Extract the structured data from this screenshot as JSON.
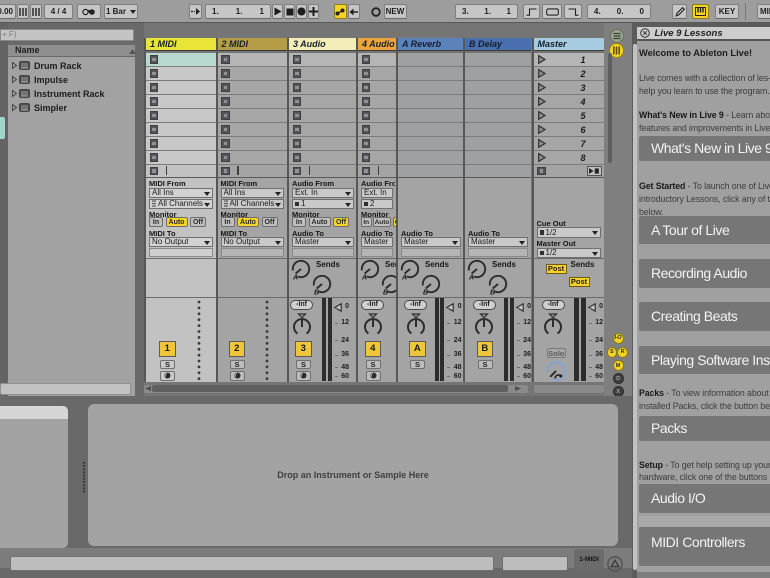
{
  "colors": {
    "accent_yellow": "#f5d329",
    "selected_slot_teal": "#b7d9cf",
    "track_colors": [
      "#e9e438",
      "#b59d48",
      "#f4edb8",
      "#eda438",
      "#5b82bb",
      "#4a6fae",
      "#a7cce2"
    ],
    "banner_grey": "#767676",
    "panel_grey": "#a0a0a0"
  },
  "control_bar": {
    "tempo_partial": "0.00",
    "time_signature": "4 / 4",
    "quantization": "1 Bar",
    "position": [
      "1",
      "1",
      "1"
    ],
    "session_record_new": "NEW",
    "loop_start": [
      "3",
      "1",
      "1"
    ],
    "loop_length": [
      "4",
      "0",
      "0"
    ],
    "key_map_label": "KEY",
    "midi_map_label_partial": "MID"
  },
  "browser": {
    "search_text_partial": "+ F)",
    "name_header": "Name",
    "items": [
      "Drum Rack",
      "Impulse",
      "Instrument Rack",
      "Simpler"
    ]
  },
  "session": {
    "tracks": [
      {
        "name": "1 MIDI",
        "color": "#e9e438",
        "kind": "midi",
        "selected": true,
        "io": {
          "from_label": "MIDI From",
          "from_value": "All Ins",
          "chan_value": "All Channels",
          "monitor_label": "Monitor",
          "monitor_active": "Auto",
          "to_label": "MIDI To",
          "to_value": "No Output"
        },
        "mixer": {
          "number": "1",
          "solo": "S",
          "arm": true,
          "meter": "dotted"
        }
      },
      {
        "name": "2 MIDI",
        "color": "#b59d48",
        "kind": "midi",
        "selected": false,
        "io": {
          "from_label": "MIDI From",
          "from_value": "All Ins",
          "chan_value": "All Channels",
          "monitor_label": "Monitor",
          "monitor_active": "Auto",
          "to_label": "MIDI To",
          "to_value": "No Output"
        },
        "mixer": {
          "number": "2",
          "solo": "S",
          "arm": true,
          "meter": "dotted"
        }
      },
      {
        "name": "3 Audio",
        "color": "#f4edb8",
        "kind": "audio",
        "selected": false,
        "io": {
          "from_label": "Audio From",
          "from_value": "Ext. In",
          "chan_value": "1",
          "monitor_label": "Monitor",
          "monitor_active": "Off",
          "to_label": "Audio To",
          "to_value": "Master"
        },
        "sends": [
          "A",
          "B"
        ],
        "mixer": {
          "number": "3",
          "solo": "S",
          "arm": true,
          "meter": "bars",
          "volume": "-Inf"
        }
      },
      {
        "name": "4 Audio",
        "color": "#eda438",
        "kind": "audio",
        "selected": false,
        "io": {
          "from_label": "Audio From",
          "from_value": "Ext. In",
          "chan_value": "2",
          "monitor_label": "Monitor",
          "monitor_active": "Off",
          "to_label": "Audio To",
          "to_value": "Master"
        },
        "sends": [
          "A",
          "B"
        ],
        "mixer": {
          "number": "4",
          "solo": "S",
          "arm": true,
          "meter": "none",
          "volume": "-Inf"
        }
      },
      {
        "name": "A Reverb",
        "color": "#5b82bb",
        "kind": "return",
        "selected": false,
        "io": {
          "to_label": "Audio To",
          "to_value": "Master"
        },
        "sends": [
          "A",
          "B"
        ],
        "mixer": {
          "number": "A",
          "solo": "S",
          "arm": false,
          "meter": "bars",
          "volume": "-Inf"
        }
      },
      {
        "name": "B Delay",
        "color": "#4a6fae",
        "kind": "return",
        "selected": false,
        "io": {
          "to_label": "Audio To",
          "to_value": "Master"
        },
        "sends": [
          "A",
          "B"
        ],
        "mixer": {
          "number": "B",
          "solo": "S",
          "arm": false,
          "meter": "bars",
          "volume": "-Inf"
        }
      },
      {
        "name": "Master",
        "color": "#a7cce2",
        "kind": "master",
        "selected": false,
        "io": {
          "cue_label": "Cue Out",
          "cue_value": "1/2",
          "master_label": "Master Out",
          "master_value": "1/2"
        },
        "post_buttons": [
          "Post",
          "Post"
        ],
        "mixer": {
          "solo": "Solo",
          "meter": "bars",
          "volume": "-Inf",
          "cue_knob": true
        }
      }
    ],
    "scenes": [
      "1",
      "2",
      "3",
      "4",
      "5",
      "6",
      "7",
      "8"
    ],
    "monitor_options": [
      "In",
      "Auto",
      "Off"
    ],
    "sends_label": "Sends",
    "db_scale": [
      "0",
      "12",
      "24",
      "36",
      "48",
      "60"
    ],
    "mixer_toggles": [
      {
        "label": "I-O",
        "on": true
      },
      {
        "label": "S",
        "on": true
      },
      {
        "label": "R",
        "on": true
      },
      {
        "label": "M",
        "on": true
      },
      {
        "label": "D",
        "on": false
      },
      {
        "label": "X",
        "on": false
      }
    ]
  },
  "detail": {
    "drop_hint": "Drop an Instrument or Sample Here",
    "device_tab_label": "1-MIDI"
  },
  "help": {
    "title": "Live 9 Lessons",
    "welcome": "Welcome to Ableton Live!",
    "intro_lines": [
      "Live comes with a collection of les-",
      "help you learn to use the program."
    ],
    "whats_new_lines": [
      {
        "bold": "What's New in Live 9",
        "rest": " - Learn abou"
      },
      {
        "bold": "",
        "rest": "features and improvements in Live"
      }
    ],
    "get_started_lines": [
      {
        "bold": "Get Started",
        "rest": " - To launch one of Live"
      },
      {
        "bold": "",
        "rest": "introductory Lessons, click any of th"
      },
      {
        "bold": "",
        "rest": "below."
      }
    ],
    "packs_lines": [
      {
        "bold": "Packs",
        "rest": " - To view information about"
      },
      {
        "bold": "",
        "rest": "installed Packs, click the button be"
      }
    ],
    "setup_lines": [
      {
        "bold": "Setup",
        "rest": " - To get help setting up your"
      },
      {
        "bold": "",
        "rest": "hardware, click one of the buttons"
      }
    ],
    "banners": [
      {
        "label": "What's New in Live 9"
      },
      {
        "label": "A Tour of Live"
      },
      {
        "label": "Recording Audio"
      },
      {
        "label": "Creating Beats"
      },
      {
        "label": "Playing Software Instruments"
      },
      {
        "label": "Packs"
      },
      {
        "label": "Audio I/O"
      },
      {
        "label": "MIDI Controllers"
      }
    ]
  }
}
